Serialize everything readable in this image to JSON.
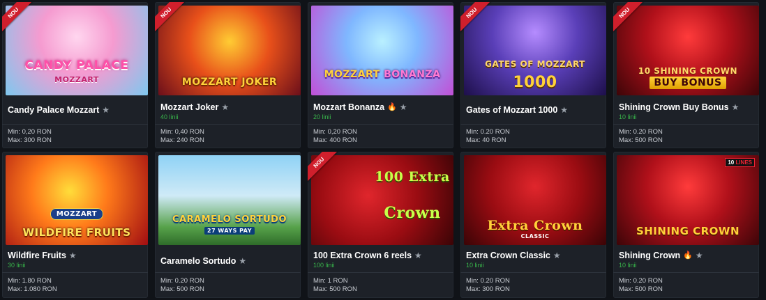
{
  "colors": {
    "background": "#101318",
    "card": "#1d2128",
    "accent_green": "#38b54a",
    "badge_red": "#d01f2c"
  },
  "games": [
    {
      "title": "Candy Palace Mozzart",
      "lines": "",
      "min": "Min: 0,20 RON",
      "max": "Max: 300 RON",
      "badge": "NOU",
      "hot": false,
      "art_line1": "CANDY PALACE",
      "art_line2": "MOZZART"
    },
    {
      "title": "Mozzart Joker",
      "lines": "40 linii",
      "min": "Min: 0,40 RON",
      "max": "Max: 240 RON",
      "badge": "NOU",
      "hot": false,
      "art_line1": "MOZZART JOKER",
      "art_line2": ""
    },
    {
      "title": "Mozzart Bonanza",
      "lines": "20 linii",
      "min": "Min: 0,20 RON",
      "max": "Max: 400 RON",
      "badge": "",
      "hot": true,
      "art_line1": "MOZZART",
      "art_line2": "BONANZA"
    },
    {
      "title": "Gates of Mozzart 1000",
      "lines": "",
      "min": "Min: 0.20 RON",
      "max": "Max: 40 RON",
      "badge": "NOU",
      "hot": false,
      "art_line1": "GATES OF MOZZART",
      "art_line2": "1000"
    },
    {
      "title": "Shining Crown Buy Bonus",
      "lines": "10 linii",
      "min": "Min: 0.20 RON",
      "max": "Max: 500 RON",
      "badge": "NOU",
      "hot": false,
      "art_line1": "10 SHINING CROWN",
      "art_line2": "BUY BONUS"
    },
    {
      "title": "Wildfire Fruits",
      "lines": "30 linii",
      "min": "Min: 1.80 RON",
      "max": "Max: 1.080 RON",
      "badge": "",
      "hot": false,
      "art_line1": "MOZZART",
      "art_line2": "WILDFIRE FRUITS"
    },
    {
      "title": "Caramelo Sortudo",
      "lines": "",
      "min": "Min: 0.20 RON",
      "max": "Max: 500 RON",
      "badge": "",
      "hot": false,
      "art_line1": "CARAMELO SORTUDO",
      "art_line2": "27 WAYS PAY"
    },
    {
      "title": "100 Extra Crown 6 reels",
      "lines": "100 linii",
      "min": "Min: 1 RON",
      "max": "Max: 500 RON",
      "badge": "NOU",
      "hot": false,
      "art_line1": "100 Extra",
      "art_line2": "Crown"
    },
    {
      "title": "Extra Crown Classic",
      "lines": "10 linii",
      "min": "Min: 0.20 RON",
      "max": "Max: 300 RON",
      "badge": "",
      "hot": false,
      "art_line1": "Extra Crown",
      "art_line2": "CLASSIC"
    },
    {
      "title": "Shining Crown",
      "lines": "10 linii",
      "min": "Min: 0.20 RON",
      "max": "Max: 500 RON",
      "badge": "",
      "hot": true,
      "art_line1": "SHINING CROWN",
      "art_line2": "10 LINES"
    }
  ]
}
